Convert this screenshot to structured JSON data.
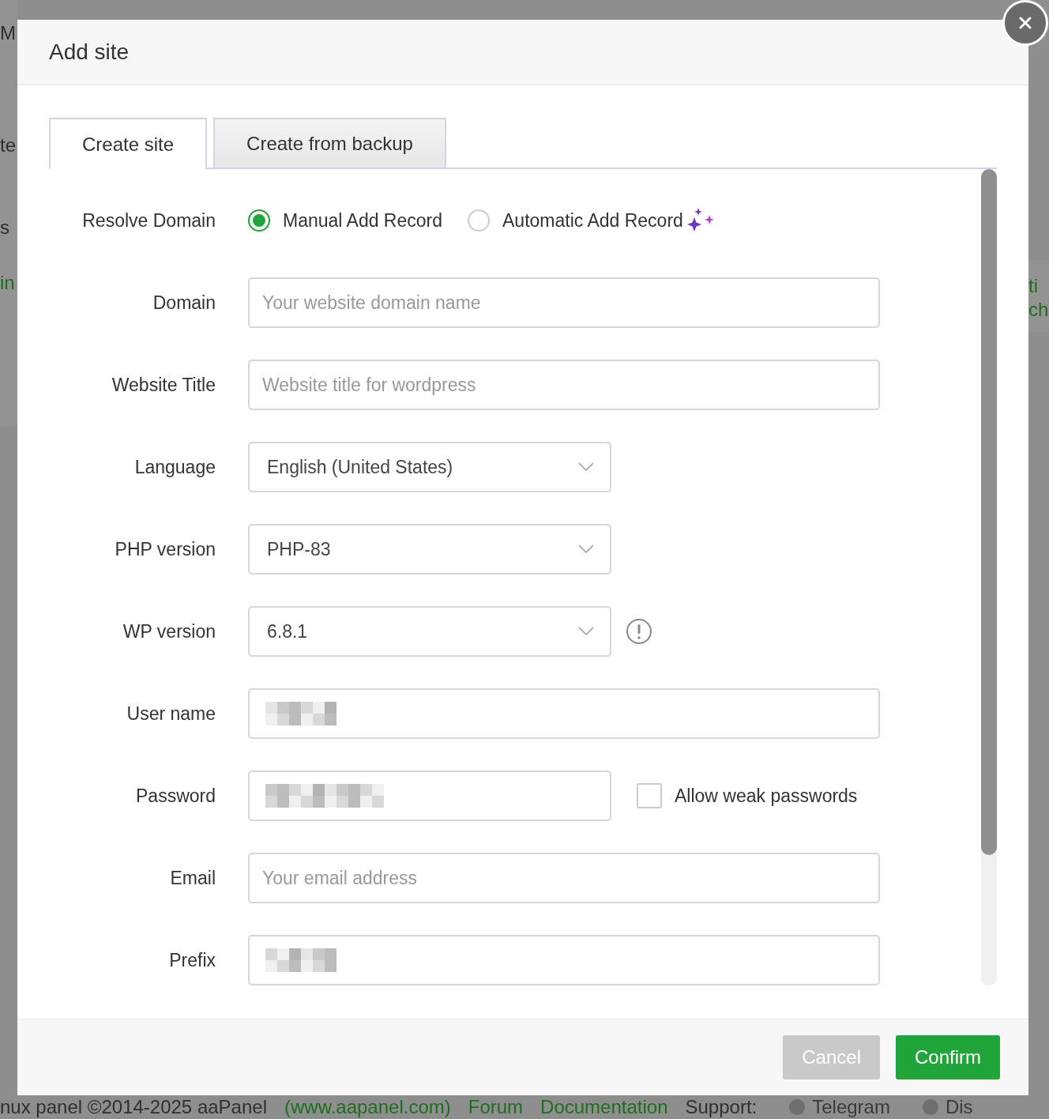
{
  "background_page": {
    "left_fragments": [
      {
        "text": "M",
        "kind": "text"
      },
      {
        "text": "te",
        "kind": "text"
      },
      {
        "text": "s",
        "kind": "text"
      },
      {
        "text": "in",
        "kind": "link"
      }
    ],
    "right_fragments": [
      {
        "text": "ti",
        "kind": "link"
      },
      {
        "text": "ch",
        "kind": "link"
      }
    ],
    "footer": [
      {
        "text": "nux panel ©2014-2025 aaPanel",
        "kind": "text"
      },
      {
        "text": "(www.aapanel.com)",
        "kind": "link"
      },
      {
        "text": "Forum",
        "kind": "link"
      },
      {
        "text": "Documentation",
        "kind": "link"
      },
      {
        "text": "Support:",
        "kind": "text"
      },
      {
        "text": "Telegram",
        "kind": "social"
      },
      {
        "text": "Dis",
        "kind": "social"
      }
    ]
  },
  "dialog": {
    "title": "Add site",
    "tabs": [
      {
        "label": "Create site",
        "selected": true
      },
      {
        "label": "Create from backup",
        "selected": false
      }
    ],
    "rows": [
      {
        "kind": "radio",
        "label": "Resolve Domain",
        "options": [
          {
            "label": "Manual Add Record",
            "selected": true,
            "sparkle": false
          },
          {
            "label": "Automatic Add Record",
            "selected": false,
            "sparkle": true
          }
        ]
      },
      {
        "kind": "input",
        "label": "Domain",
        "placeholder": "Your website domain name",
        "wide": true
      },
      {
        "kind": "input",
        "label": "Website Title",
        "placeholder": "Website title for wordpress",
        "wide": true
      },
      {
        "kind": "select",
        "label": "Language",
        "value": "English (United States)",
        "wide": false
      },
      {
        "kind": "select",
        "label": "PHP version",
        "value": "PHP-83",
        "wide": false
      },
      {
        "kind": "select",
        "label": "WP version",
        "value": "6.8.1",
        "wide": false,
        "info": true
      },
      {
        "kind": "input",
        "label": "User name",
        "redacted": true,
        "wide": true
      },
      {
        "kind": "input",
        "label": "Password",
        "redacted": true,
        "wide": false,
        "checkbox": {
          "label": "Allow weak passwords",
          "checked": false
        }
      },
      {
        "kind": "input",
        "label": "Email",
        "placeholder": "Your email address",
        "wide": true
      },
      {
        "kind": "input",
        "label": "Prefix",
        "redacted": true,
        "wide": true
      }
    ],
    "buttons": [
      {
        "label": "Cancel",
        "kind": "secondary"
      },
      {
        "label": "Confirm",
        "kind": "primary"
      }
    ]
  }
}
